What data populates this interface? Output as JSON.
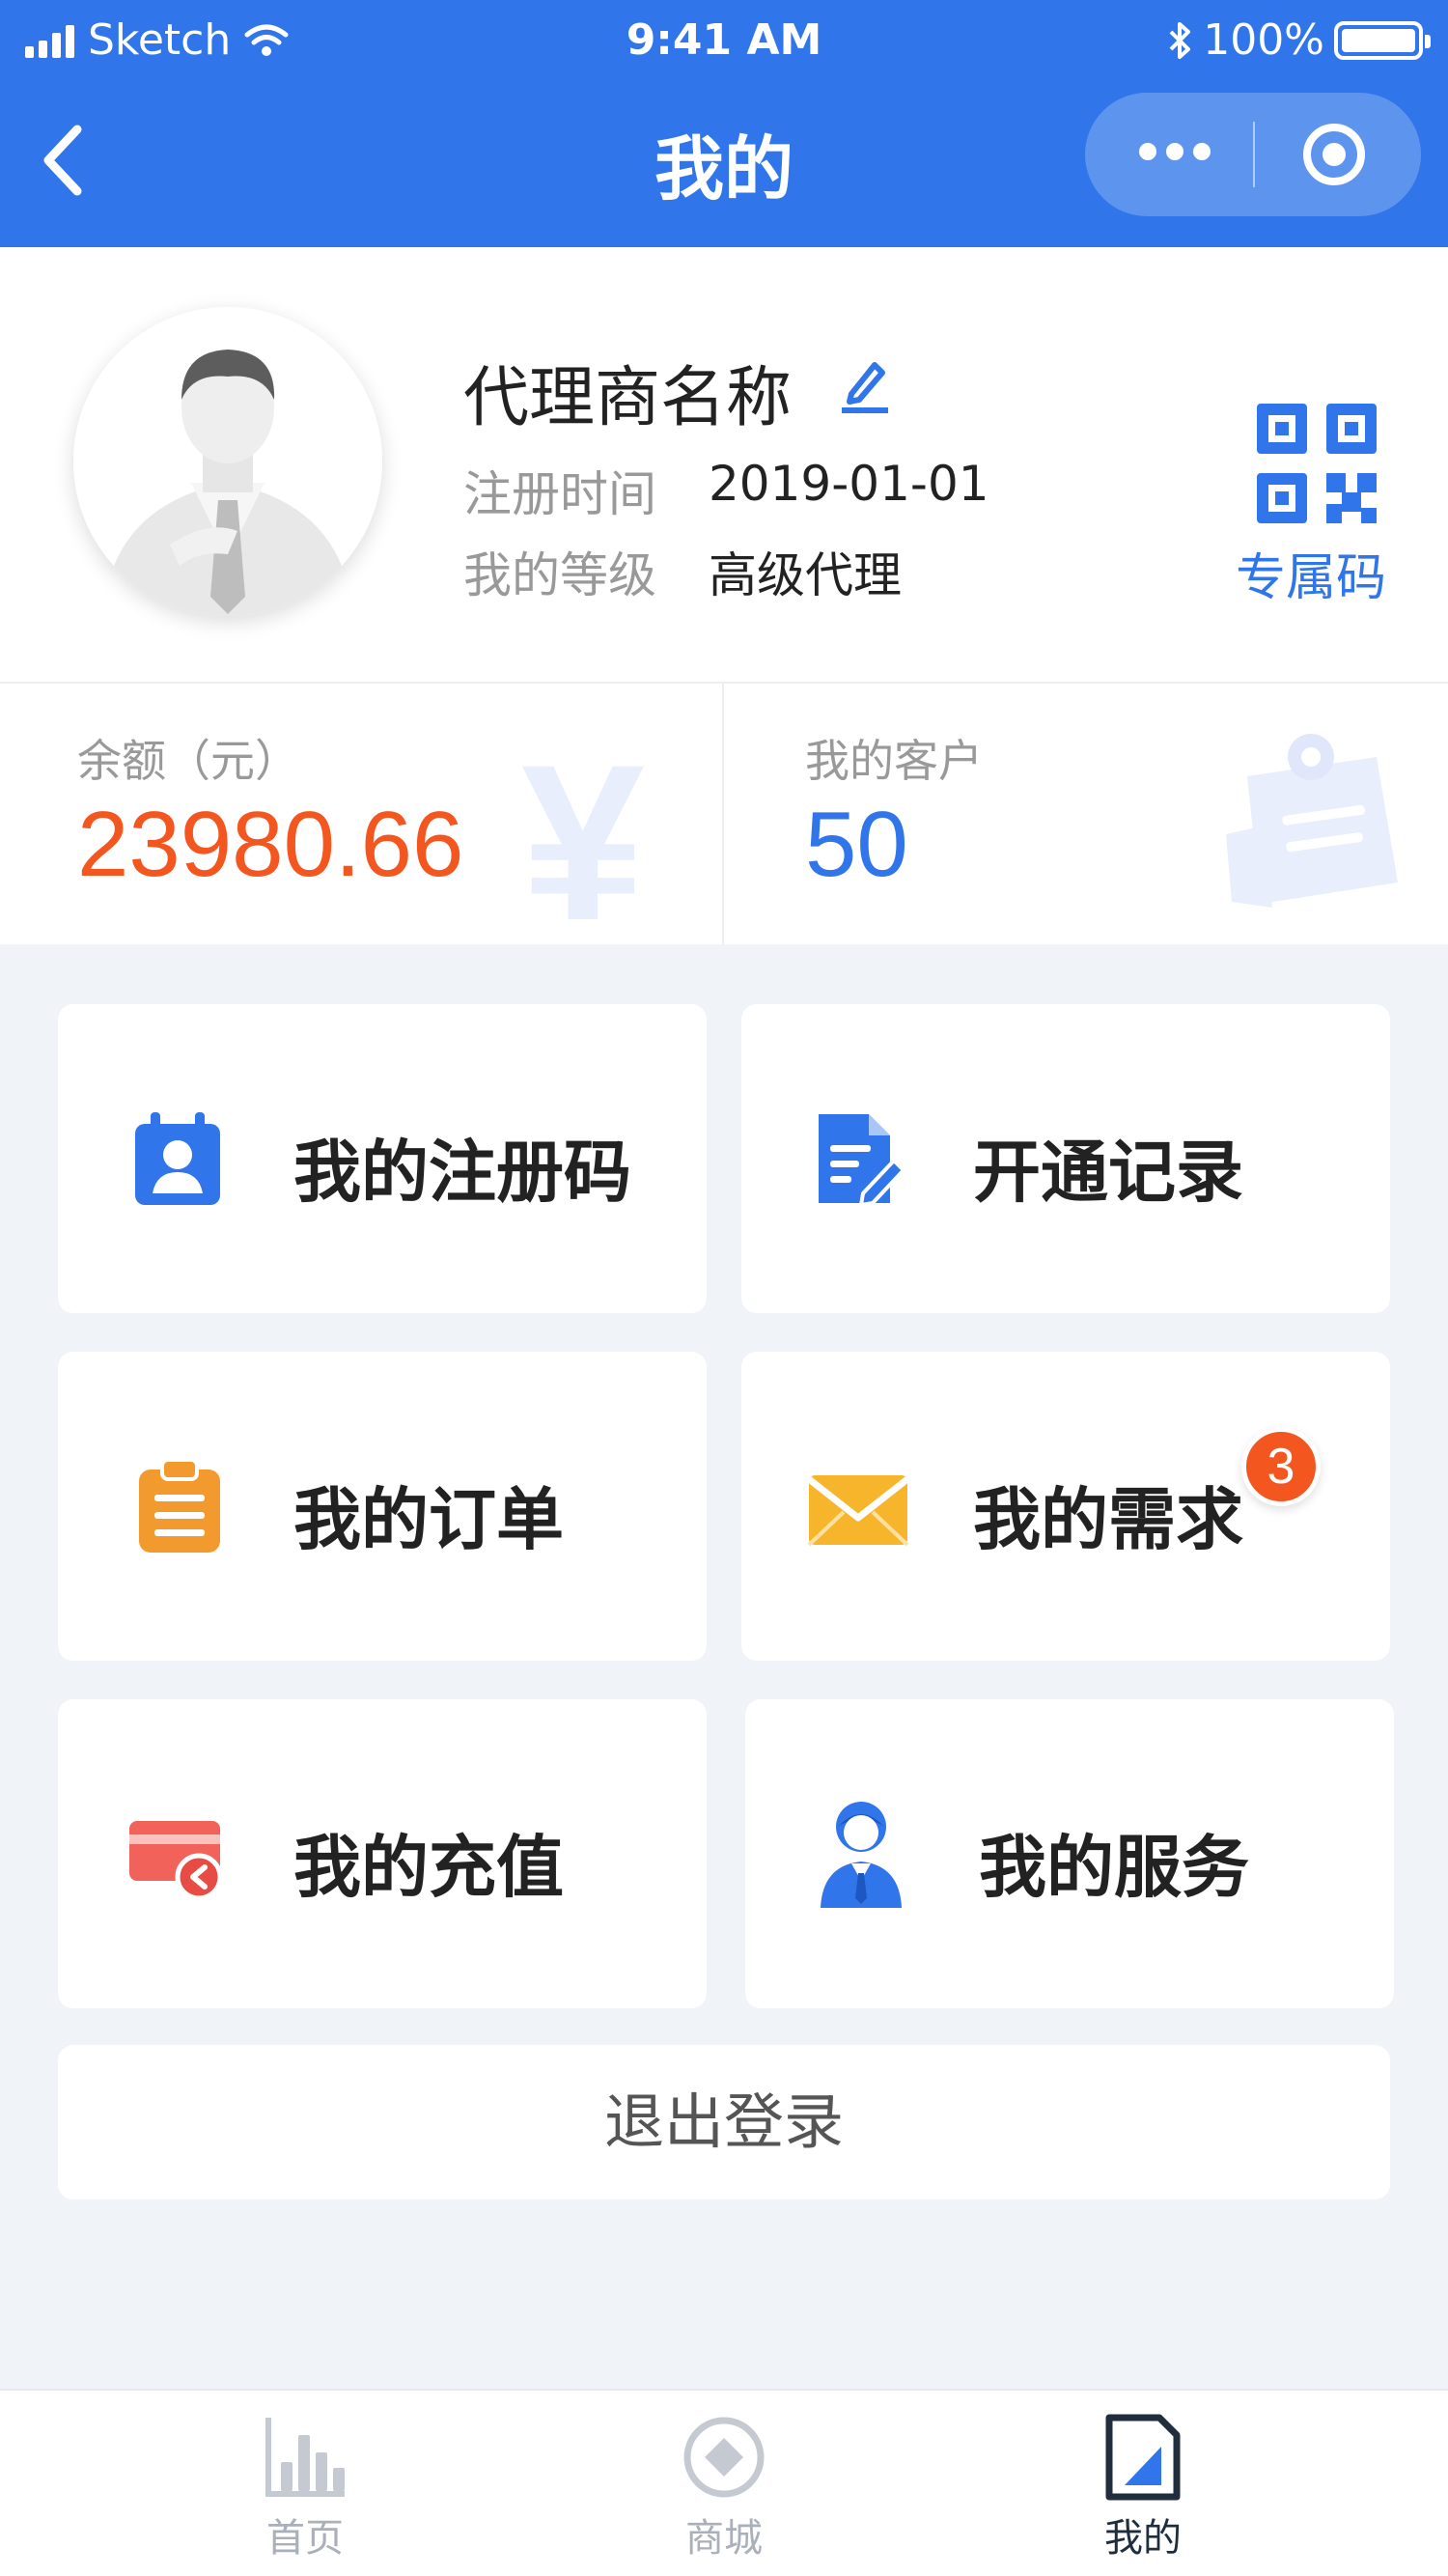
{
  "status_bar": {
    "carrier": "Sketch",
    "time": "9:41 AM",
    "battery": "100%"
  },
  "nav": {
    "title": "我的"
  },
  "profile": {
    "name": "代理商名称",
    "register_label": "注册时间",
    "register_value": "2019-01-01",
    "level_label": "我的等级",
    "level_value": "高级代理",
    "qr_label": "专属码"
  },
  "stats": {
    "balance_label": "余额（元）",
    "balance_value": "23980.66",
    "customers_label": "我的客户",
    "customers_value": "50",
    "watermark_currency": "¥"
  },
  "menu": [
    {
      "label": "我的注册码",
      "icon": "contact-card-icon"
    },
    {
      "label": "开通记录",
      "icon": "document-edit-icon"
    },
    {
      "label": "我的订单",
      "icon": "clipboard-icon"
    },
    {
      "label": "我的需求",
      "icon": "envelope-icon",
      "badge": "3"
    },
    {
      "label": "我的充值",
      "icon": "card-recharge-icon"
    },
    {
      "label": "我的服务",
      "icon": "service-person-icon"
    }
  ],
  "logout_label": "退出登录",
  "tabs": [
    {
      "label": "首页",
      "icon": "bar-chart-icon",
      "active": false
    },
    {
      "label": "商城",
      "icon": "diamond-circle-icon",
      "active": false
    },
    {
      "label": "我的",
      "icon": "profile-doc-icon",
      "active": true
    }
  ],
  "colors": {
    "primary": "#3076ea",
    "balance": "#f3561f",
    "badge": "#f3561f",
    "tab_active": "#1f2d3d",
    "tab_inactive": "#a9b0ba"
  }
}
